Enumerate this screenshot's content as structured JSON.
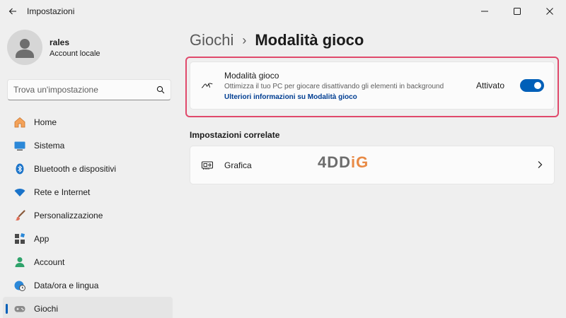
{
  "window": {
    "title": "Impostazioni",
    "back_icon": "arrow-left-icon",
    "controls": [
      "minimize-icon",
      "maximize-icon",
      "close-icon"
    ]
  },
  "user": {
    "name": "rales",
    "account_type": "Account locale"
  },
  "search": {
    "placeholder": "Trova un'impostazione",
    "value": "",
    "icon": "search-icon"
  },
  "nav": {
    "items": [
      {
        "label": "Home",
        "icon": "home-icon"
      },
      {
        "label": "Sistema",
        "icon": "system-icon"
      },
      {
        "label": "Bluetooth e dispositivi",
        "icon": "bluetooth-icon"
      },
      {
        "label": "Rete e Internet",
        "icon": "wifi-icon"
      },
      {
        "label": "Personalizzazione",
        "icon": "brush-icon"
      },
      {
        "label": "App",
        "icon": "apps-icon"
      },
      {
        "label": "Account",
        "icon": "account-icon"
      },
      {
        "label": "Data/ora e lingua",
        "icon": "globe-clock-icon"
      },
      {
        "label": "Giochi",
        "icon": "gamepad-icon",
        "active": true
      }
    ]
  },
  "breadcrumb": {
    "parent": "Giochi",
    "separator": "›",
    "current": "Modalità gioco"
  },
  "game_mode": {
    "title": "Modalità gioco",
    "description": "Ottimizza il tuo PC per giocare disattivando gli elementi in background",
    "link": "Ulteriori informazioni su Modalità gioco",
    "state_label": "Attivato",
    "enabled": true,
    "icon": "game-mode-icon"
  },
  "related": {
    "heading": "Impostazioni correlate",
    "items": [
      {
        "label": "Grafica",
        "icon": "graphics-card-icon"
      }
    ]
  },
  "watermark": {
    "text_main": "4DD",
    "text_accent": "iG"
  },
  "colors": {
    "accent": "#005fb8",
    "highlight": "#e0496b",
    "background": "#efefef",
    "card": "#fbfbfb"
  }
}
